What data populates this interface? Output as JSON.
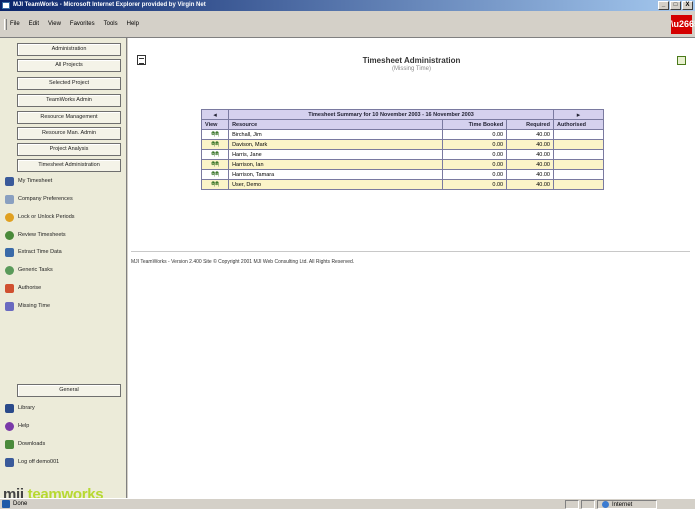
{
  "window": {
    "title": "MJI TeamWorks - Microsoft Internet Explorer provided by Virgin Net",
    "controls": [
      "_",
      "□",
      "X"
    ]
  },
  "menu": {
    "items": [
      "File",
      "Edit",
      "View",
      "Favorites",
      "Tools",
      "Help"
    ]
  },
  "sidebar": {
    "buttons": [
      "Administration",
      "All Projects",
      "Selected Project",
      "TeamWorks Admin",
      "Resource Management",
      "Resource Man. Admin",
      "Project Analysis",
      "Timesheet Administration"
    ],
    "links": [
      {
        "label": "My Timesheet",
        "icon": "timesheet-icon",
        "color": "#3a5a9a"
      },
      {
        "label": "Company Preferences",
        "icon": "preferences-icon",
        "color": "#8aa0c0"
      },
      {
        "label": "Lock or Unlock Periods",
        "icon": "lock-icon",
        "color": "#e0a020"
      },
      {
        "label": "Review Timesheets",
        "icon": "review-icon",
        "color": "#4a8a3a"
      },
      {
        "label": "Extract Time Data",
        "icon": "extract-icon",
        "color": "#3a6aa8"
      },
      {
        "label": "Generic Tasks",
        "icon": "tasks-icon",
        "color": "#5a9a5a"
      },
      {
        "label": "Authorise",
        "icon": "authorise-icon",
        "color": "#d05030"
      },
      {
        "label": "Missing Time",
        "icon": "missing-time-icon",
        "color": "#6a6ac0"
      }
    ],
    "general_button": "General",
    "general_links": [
      {
        "label": "Library",
        "icon": "library-icon",
        "color": "#2a4a8a"
      },
      {
        "label": "Help",
        "icon": "help-icon",
        "color": "#7a3aa8"
      },
      {
        "label": "Downloads",
        "icon": "downloads-icon",
        "color": "#4a8a3a"
      },
      {
        "label": "Log off demo001",
        "icon": "logoff-icon",
        "color": "#3a5a9a"
      }
    ],
    "brand_prefix": "mji",
    "brand_name": "teamworks"
  },
  "main": {
    "title": "Timesheet Administration",
    "subtitle": "(Missing Time)",
    "table": {
      "caption": "Timesheet Summary for 10 November 2003 - 16 November 2003",
      "prev_label": "◂",
      "next_label": "▸",
      "headers": [
        "View",
        "Resource",
        "Time Booked",
        "Required",
        "Authorised"
      ],
      "rows": [
        {
          "view": "෧෧",
          "resource": "Birchall, Jim",
          "booked": "0.00",
          "required": "40.00",
          "authorised": ""
        },
        {
          "view": "෧෧",
          "resource": "Davison, Mark",
          "booked": "0.00",
          "required": "40.00",
          "authorised": ""
        },
        {
          "view": "෧෧",
          "resource": "Harris, Jane",
          "booked": "0.00",
          "required": "40.00",
          "authorised": ""
        },
        {
          "view": "෧෧",
          "resource": "Harrison, Ian",
          "booked": "0.00",
          "required": "40.00",
          "authorised": ""
        },
        {
          "view": "෧෧",
          "resource": "Harrison, Tamara",
          "booked": "0.00",
          "required": "40.00",
          "authorised": ""
        },
        {
          "view": "෧෧",
          "resource": "User, Demo",
          "booked": "0.00",
          "required": "40.00",
          "authorised": ""
        }
      ]
    },
    "footer": "MJI TeamWorks - Version 2.400   Site © Copyright 2001 MJI Web Consulting Ltd. All Rights Reserved."
  },
  "status": {
    "left": "Done",
    "zone": "Internet"
  },
  "colors": {
    "header_fill": "#d5d1ee",
    "alt_row_fill": "#fbf4c8",
    "brand_accent": "#b7d932",
    "corner_logo": "#d40000"
  }
}
